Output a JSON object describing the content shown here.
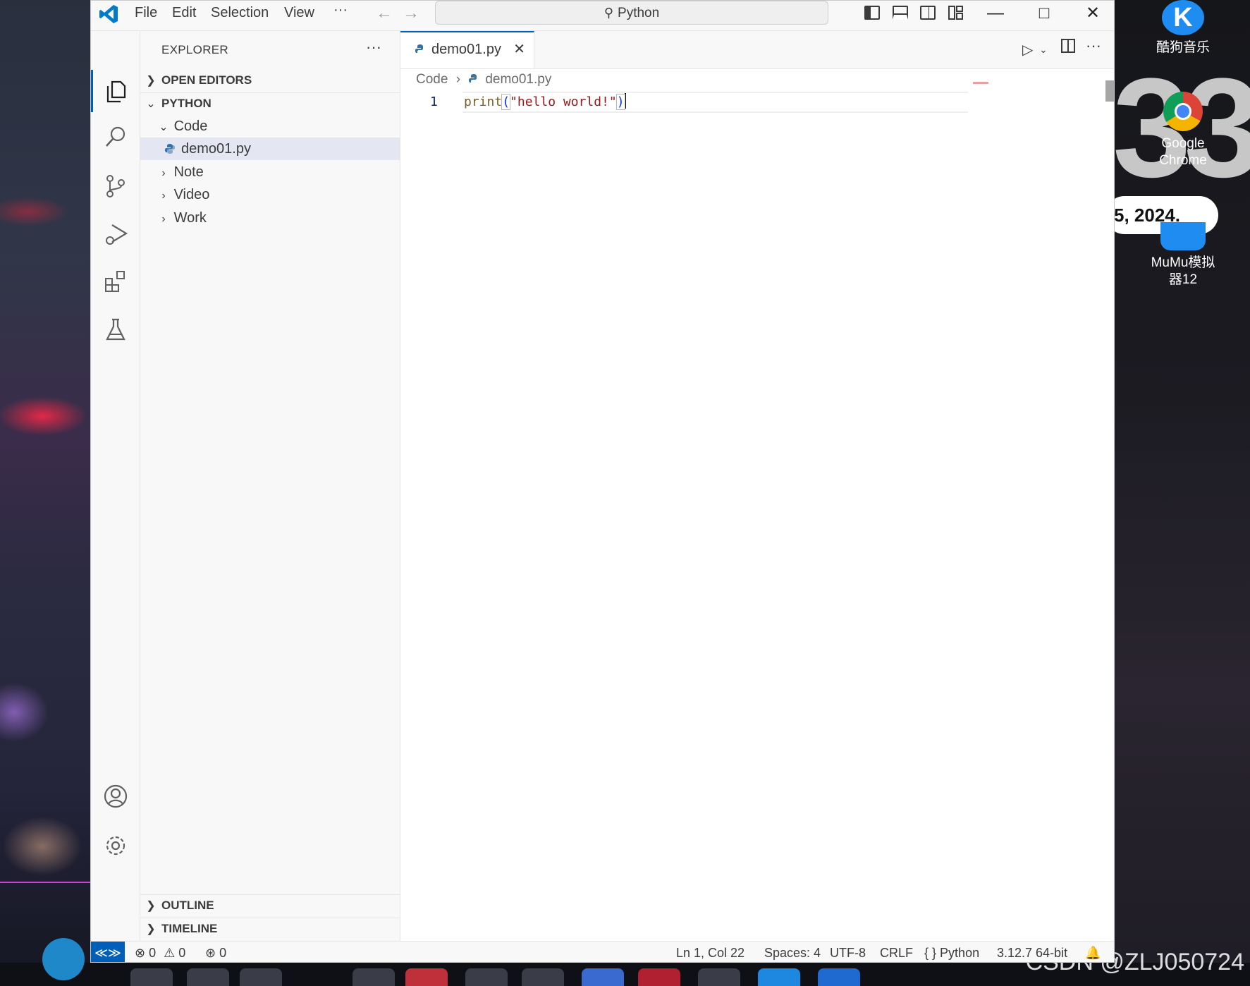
{
  "window": {
    "menu": [
      "File",
      "Edit",
      "Selection",
      "View",
      "···"
    ],
    "command_center": "Python"
  },
  "explorer": {
    "title": "EXPLORER",
    "more": "···",
    "open_editors": "OPEN EDITORS",
    "workspace": "PYTHON",
    "tree": [
      {
        "label": "Code",
        "expanded": true
      },
      {
        "label": "demo01.py",
        "selected": true
      },
      {
        "label": "Note"
      },
      {
        "label": "Video"
      },
      {
        "label": "Work"
      }
    ],
    "outline": "OUTLINE",
    "timeline": "TIMELINE"
  },
  "editor": {
    "tab_label": "demo01.py",
    "breadcrumb_folder": "Code",
    "breadcrumb_file": "demo01.py",
    "line_number": "1",
    "code": {
      "fn": "print",
      "open_paren": "(",
      "string": "\"hello world!\"",
      "close_paren": ")"
    }
  },
  "statusbar": {
    "errors": "0",
    "warnings": "0",
    "ports": "0",
    "position": "Ln 1, Col 22",
    "spaces": "Spaces: 4",
    "encoding": "UTF-8",
    "eol": "CRLF",
    "language": "Python",
    "interpreter": "3.12.7 64-bit"
  },
  "desktop": {
    "icons": [
      {
        "label": "酷狗音乐"
      },
      {
        "label": "Google Chrome"
      },
      {
        "label": "MuMu模拟器12"
      }
    ],
    "clock_big": "33",
    "date_fragment": "5, 2024.",
    "watermark": "CSDN @ZLJ050724"
  },
  "colors": {
    "accent": "#005fb8",
    "selection": "#e4e6f1",
    "string": "#a31515",
    "function": "#795e26"
  }
}
